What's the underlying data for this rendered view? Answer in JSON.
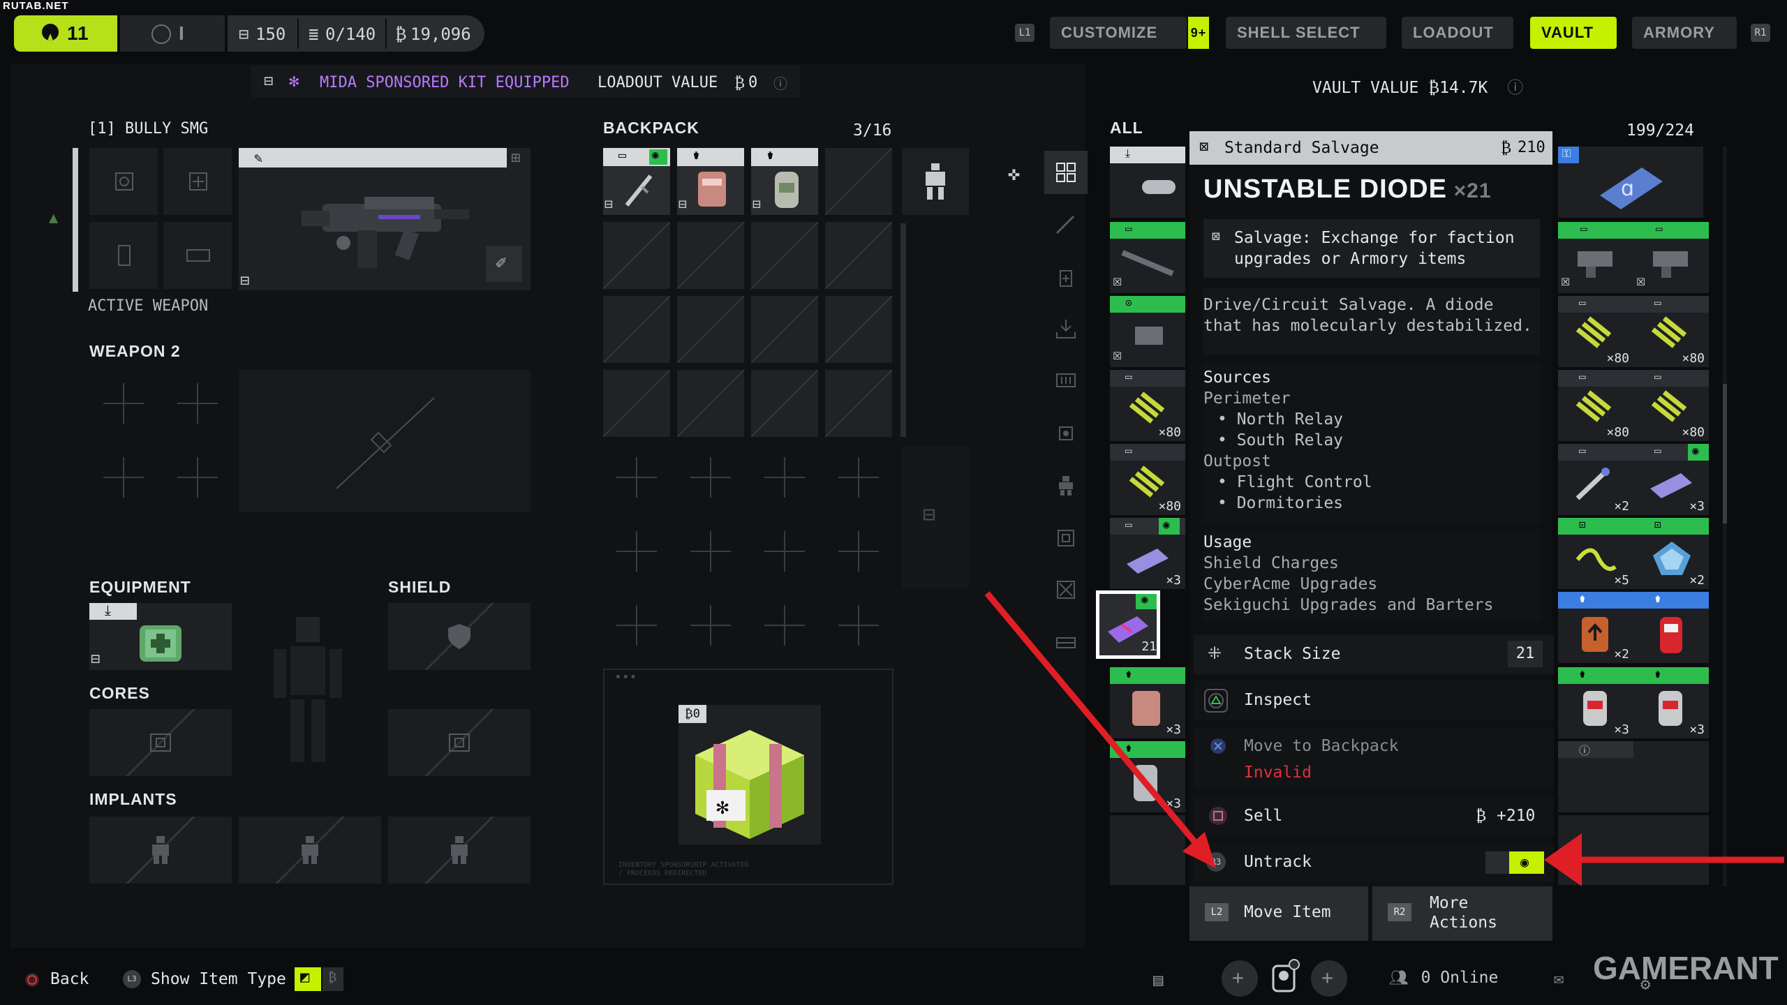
{
  "watermark": "RUTAB.NET",
  "topbar": {
    "level": "11",
    "rank": "I",
    "stat1": "150",
    "stat2": "0/140",
    "credits": "19,096",
    "nav": [
      "CUSTOMIZE",
      "SHELL SELECT",
      "LOADOUT",
      "VAULT",
      "ARMORY"
    ],
    "customize_badge": "9+",
    "active_nav": "VAULT",
    "l1": "L1",
    "r1": "R1"
  },
  "kit": {
    "text": "MIDA SPONSORED KIT EQUIPPED",
    "loadout_value": "LOADOUT VALUE",
    "loadout_amount": "0"
  },
  "vault_value": {
    "label": "VAULT VALUE",
    "amount": "14.7K"
  },
  "loadout": {
    "weapon1_label": "[1] BULLY SMG",
    "active_weapon": "ACTIVE WEAPON",
    "weapon2": "WEAPON 2",
    "equipment": "EQUIPMENT",
    "shield": "SHIELD",
    "cores": "CORES",
    "implants": "IMPLANTS"
  },
  "backpack": {
    "title": "BACKPACK",
    "capacity": "3/16",
    "sponsor_value": "0",
    "sponsor_note1": "INVENTORY SPONSORSHIP ACTIVATED",
    "sponsor_note2": "/ PROCEEDS REDIRECTED"
  },
  "vault": {
    "filter": "ALL",
    "capacity": "199/224",
    "left_qty": [
      "",
      "",
      "",
      "×80",
      "×80",
      "×3",
      "21",
      "×3",
      "×3"
    ],
    "right_qty": [
      "",
      "",
      "",
      "×80",
      "×80",
      "×80",
      "×80",
      "×2",
      "×3",
      "×5",
      "×2",
      "×2",
      "",
      "×3",
      "×3",
      ""
    ]
  },
  "detail": {
    "category": "Standard Salvage",
    "price": "210",
    "title": "UNSTABLE DIODE",
    "count": "×21",
    "salvage": "Salvage: Exchange for faction upgrades or Armory items",
    "desc": "Drive/Circuit Salvage. A diode that has molecularly destabilized.",
    "sources_title": "Sources",
    "sources": [
      {
        "area": "Perimeter",
        "spots": [
          "North Relay",
          "South Relay"
        ]
      },
      {
        "area": "Outpost",
        "spots": [
          "Flight Control",
          "Dormitories"
        ]
      }
    ],
    "usage_title": "Usage",
    "usage": [
      "Shield Charges",
      "CyberAcme Upgrades",
      "Sekiguchi Upgrades and Barters"
    ],
    "stack_label": "Stack Size",
    "stack_value": "21",
    "inspect": "Inspect",
    "move_backpack": "Move to Backpack",
    "invalid": "Invalid",
    "sell": "Sell",
    "sell_value": "+210",
    "untrack": "Untrack",
    "r3": "R3",
    "move_item": "Move Item",
    "l2": "L2",
    "more_actions": "More Actions",
    "r2": "R2"
  },
  "bottombar": {
    "back": "Back",
    "show_type": "Show Item Type",
    "l3": "L3",
    "online": "0 Online",
    "brand": "GAMERANT"
  },
  "colors": {
    "accent": "#c6f000",
    "green": "#2dbd4e",
    "invalid": "#e0323c",
    "arrow": "#e01e25",
    "purple": "#b77bff"
  }
}
